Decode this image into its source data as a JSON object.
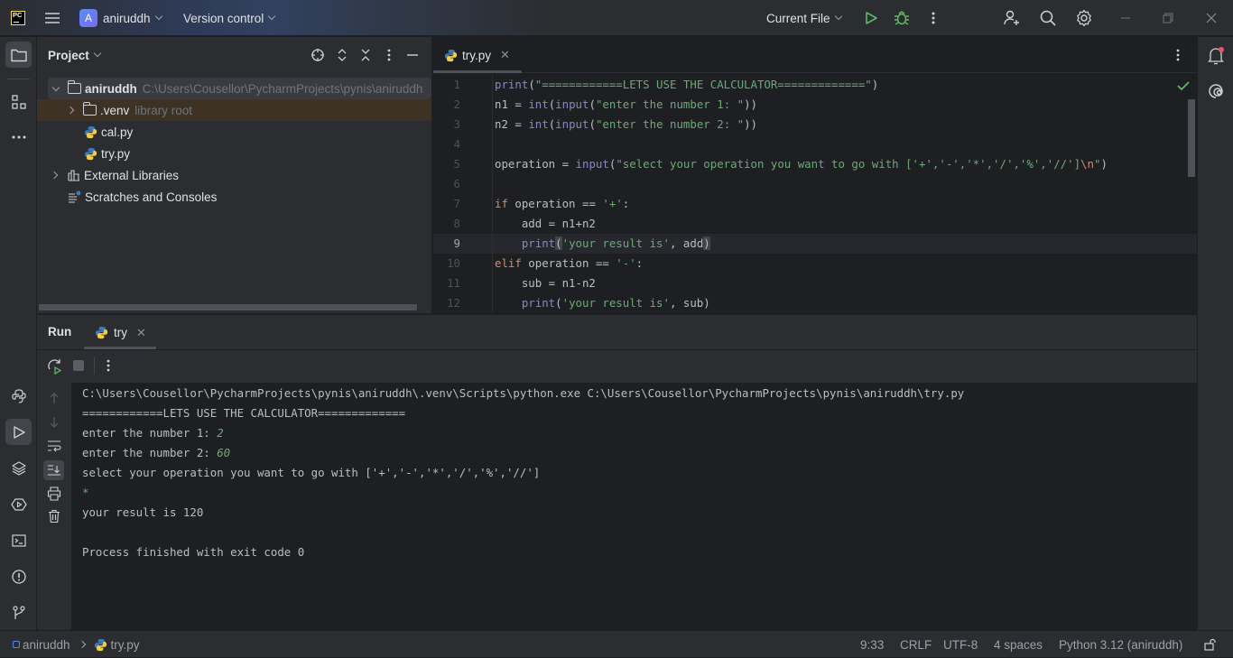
{
  "titlebar": {
    "project_initial": "A",
    "project_name": "aniruddh",
    "vcs_label": "Version control",
    "run_config": "Current File"
  },
  "project_panel": {
    "title": "Project",
    "tree": [
      {
        "label": "aniruddh",
        "hint": "C:\\Users\\Cousellor\\PycharmProjects\\pynis\\aniruddh",
        "type": "folder",
        "expanded": true
      },
      {
        "label": ".venv",
        "hint": "library root",
        "type": "folder",
        "expanded": false
      },
      {
        "label": "cal.py",
        "hint": "",
        "type": "python-file"
      },
      {
        "label": "try.py",
        "hint": "",
        "type": "python-file"
      },
      {
        "label": "External Libraries",
        "hint": "",
        "type": "library"
      },
      {
        "label": "Scratches and Consoles",
        "hint": "",
        "type": "scratches"
      }
    ]
  },
  "editor": {
    "active_tab": "try.py",
    "current_line": 9,
    "lines": [
      {
        "n": "1",
        "tokens": [
          [
            "fn",
            "print"
          ],
          [
            "id",
            "("
          ],
          [
            "str",
            "\"============LETS USE THE CALCULATOR=============\""
          ],
          [
            "id",
            ")"
          ]
        ]
      },
      {
        "n": "2",
        "tokens": [
          [
            "id",
            "n1 = "
          ],
          [
            "fn",
            "int"
          ],
          [
            "id",
            "("
          ],
          [
            "fn",
            "input"
          ],
          [
            "id",
            "("
          ],
          [
            "str",
            "\"enter the number 1: \""
          ],
          [
            "id",
            "))"
          ]
        ]
      },
      {
        "n": "3",
        "tokens": [
          [
            "id",
            "n2 = "
          ],
          [
            "fn",
            "int"
          ],
          [
            "id",
            "("
          ],
          [
            "fn",
            "input"
          ],
          [
            "id",
            "("
          ],
          [
            "str",
            "\"enter the number 2: \""
          ],
          [
            "id",
            "))"
          ]
        ]
      },
      {
        "n": "4",
        "tokens": []
      },
      {
        "n": "5",
        "tokens": [
          [
            "id",
            "operation = "
          ],
          [
            "fn",
            "input"
          ],
          [
            "id",
            "("
          ],
          [
            "str",
            "\"select your operation you want to go with ['+','-','*','/','%','//']"
          ],
          [
            "esc",
            "\\n"
          ],
          [
            "str",
            "\""
          ],
          [
            "id",
            ")"
          ]
        ]
      },
      {
        "n": "6",
        "tokens": []
      },
      {
        "n": "7",
        "tokens": [
          [
            "kw",
            "if"
          ],
          [
            "id",
            " operation == "
          ],
          [
            "str",
            "'+'"
          ],
          [
            "id",
            ":"
          ]
        ]
      },
      {
        "n": "8",
        "tokens": [
          [
            "id",
            "    add = n1+n2"
          ]
        ]
      },
      {
        "n": "9",
        "tokens": [
          [
            "id",
            "    "
          ],
          [
            "fn",
            "print"
          ],
          [
            "hl",
            "("
          ],
          [
            "str",
            "'your result is'"
          ],
          [
            "id",
            ", add"
          ],
          [
            "hl",
            ")"
          ]
        ]
      },
      {
        "n": "10",
        "tokens": [
          [
            "kw",
            "elif"
          ],
          [
            "id",
            " operation == "
          ],
          [
            "str",
            "'-'"
          ],
          [
            "id",
            ":"
          ]
        ]
      },
      {
        "n": "11",
        "tokens": [
          [
            "id",
            "    sub = n1-n2"
          ]
        ]
      },
      {
        "n": "12",
        "tokens": [
          [
            "fn",
            "    print"
          ],
          [
            "id",
            "("
          ],
          [
            "str",
            "'your result is'"
          ],
          [
            "id",
            ", sub)"
          ]
        ]
      }
    ]
  },
  "run_panel": {
    "title": "Run",
    "tab_label": "try",
    "console": [
      {
        "text": "C:\\Users\\Cousellor\\PycharmProjects\\pynis\\aniruddh\\.venv\\Scripts\\python.exe C:\\Users\\Cousellor\\PycharmProjects\\pynis\\aniruddh\\try.py",
        "input": ""
      },
      {
        "text": "============LETS USE THE CALCULATOR=============",
        "input": ""
      },
      {
        "text": "enter the number 1: ",
        "input": "2"
      },
      {
        "text": "enter the number 2: ",
        "input": "60"
      },
      {
        "text": "select your operation you want to go with ['+','-','*','/','%','//']",
        "input": ""
      },
      {
        "text": "",
        "input": "*"
      },
      {
        "text": "your result is 120",
        "input": ""
      },
      {
        "text": "",
        "input": ""
      },
      {
        "text": "Process finished with exit code 0",
        "input": ""
      }
    ]
  },
  "statusbar": {
    "breadcrumb_project": "aniruddh",
    "breadcrumb_file": "try.py",
    "caret_position": "9:33",
    "line_separator": "CRLF",
    "encoding": "UTF-8",
    "indent": "4 spaces",
    "interpreter": "Python 3.12 (aniruddh)"
  },
  "colors": {
    "accent_green": "#5fb865",
    "notification_dot": "#e55765",
    "string": "#6aab73",
    "keyword": "#cf8e6d",
    "builtin": "#8888c6"
  }
}
